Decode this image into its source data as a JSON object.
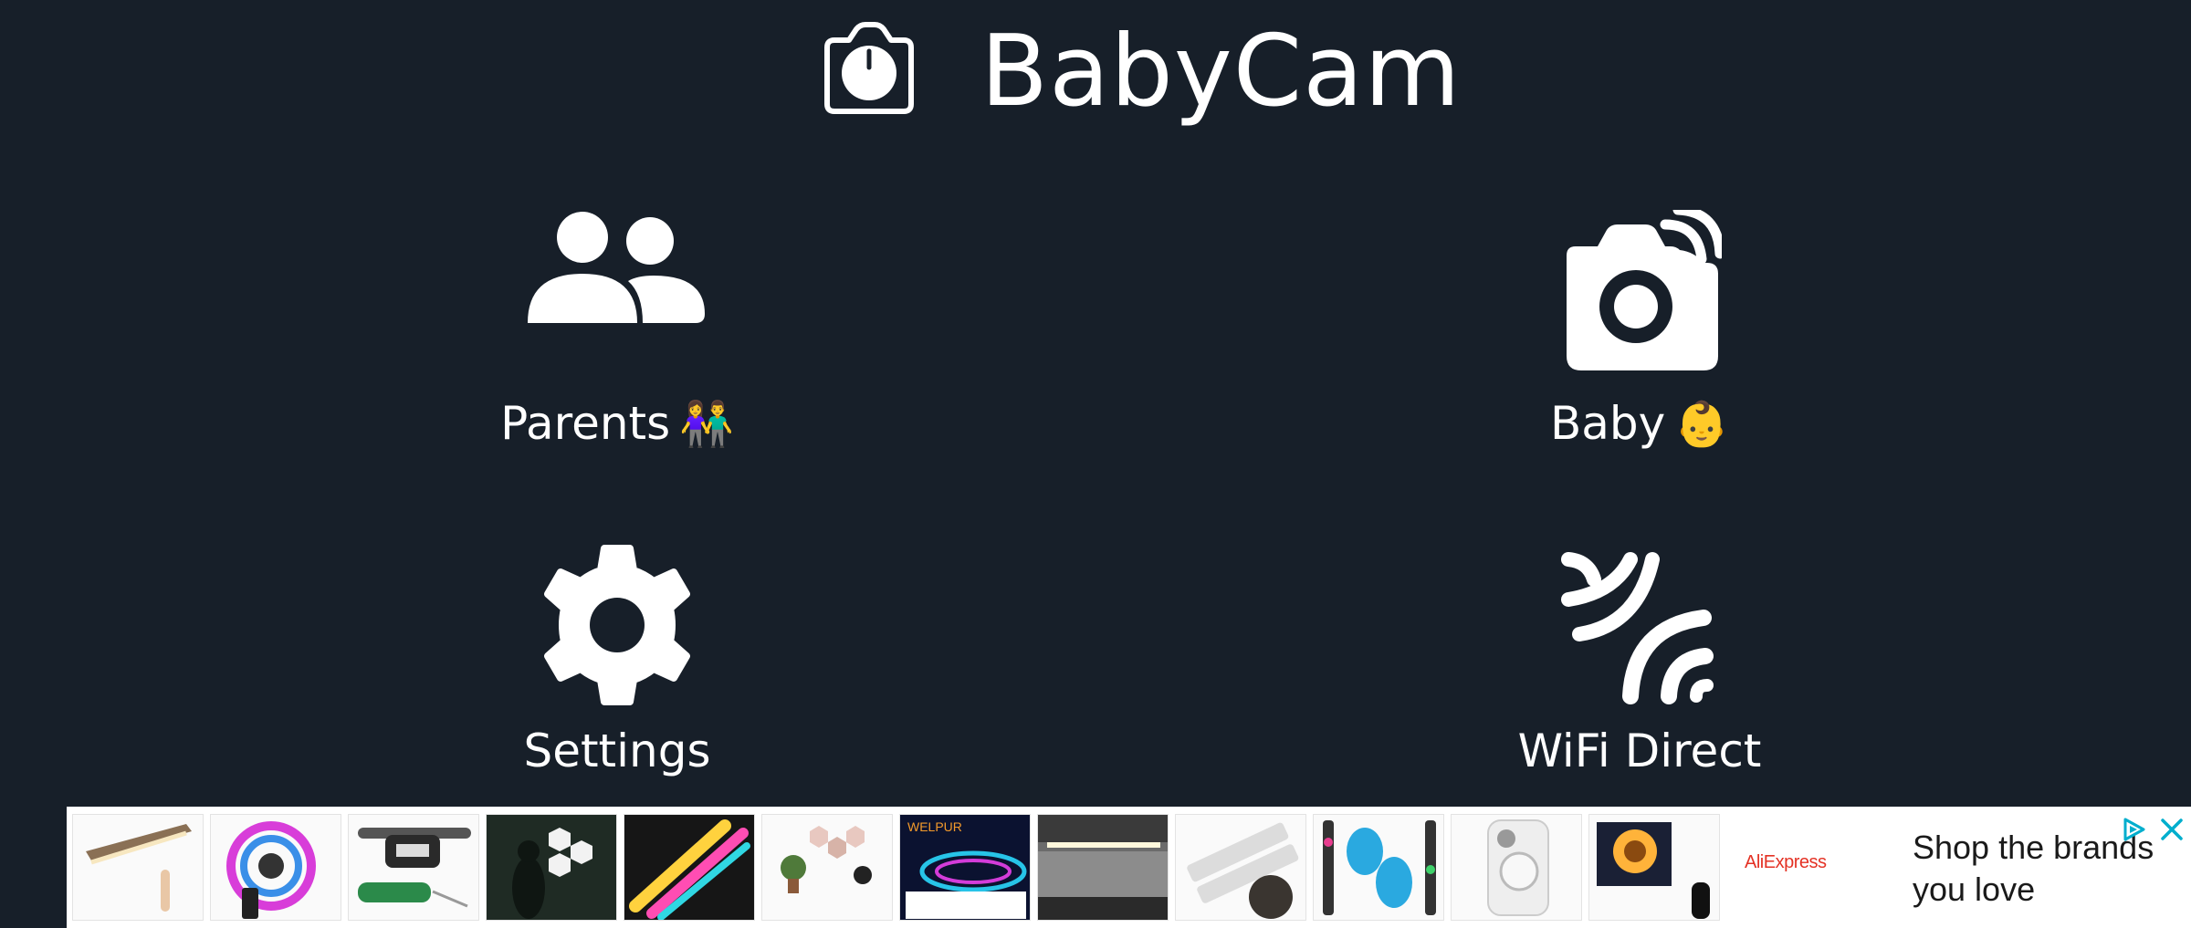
{
  "app": {
    "title": "BabyCam",
    "logo_icon": "camera-lens-icon"
  },
  "tiles": [
    {
      "id": "parents",
      "label": "Parents",
      "emoji": "👫",
      "icon": "people-icon"
    },
    {
      "id": "baby",
      "label": "Baby",
      "emoji": "👶",
      "icon": "camera-broadcast-icon"
    },
    {
      "id": "settings",
      "label": "Settings",
      "emoji": "",
      "icon": "gear-icon"
    },
    {
      "id": "wifi",
      "label": "WiFi Direct",
      "emoji": "",
      "icon": "wifi-signal-icon"
    }
  ],
  "ad": {
    "brand": "AliExpress",
    "headline": "Shop the brands you love",
    "choices_icon": "ad-choices-icon",
    "close_icon": "close-icon",
    "thumbnails": [
      "led-cabinet-light",
      "rgb-led-strip",
      "led-headlamp",
      "hexagon-wall-lights",
      "rgb-light-bars",
      "hexagon-panels",
      "welpur-led-strip",
      "under-cabinet-light",
      "motion-sensor-light-bars",
      "toilet-night-light",
      "phone-grip",
      "spiral-wall-lamp"
    ]
  },
  "colors": {
    "background": "#171f29",
    "foreground": "#ffffff",
    "ad_background": "#ffffff",
    "brand_red": "#e43225",
    "ad_icon_blue": "#00aecd"
  }
}
